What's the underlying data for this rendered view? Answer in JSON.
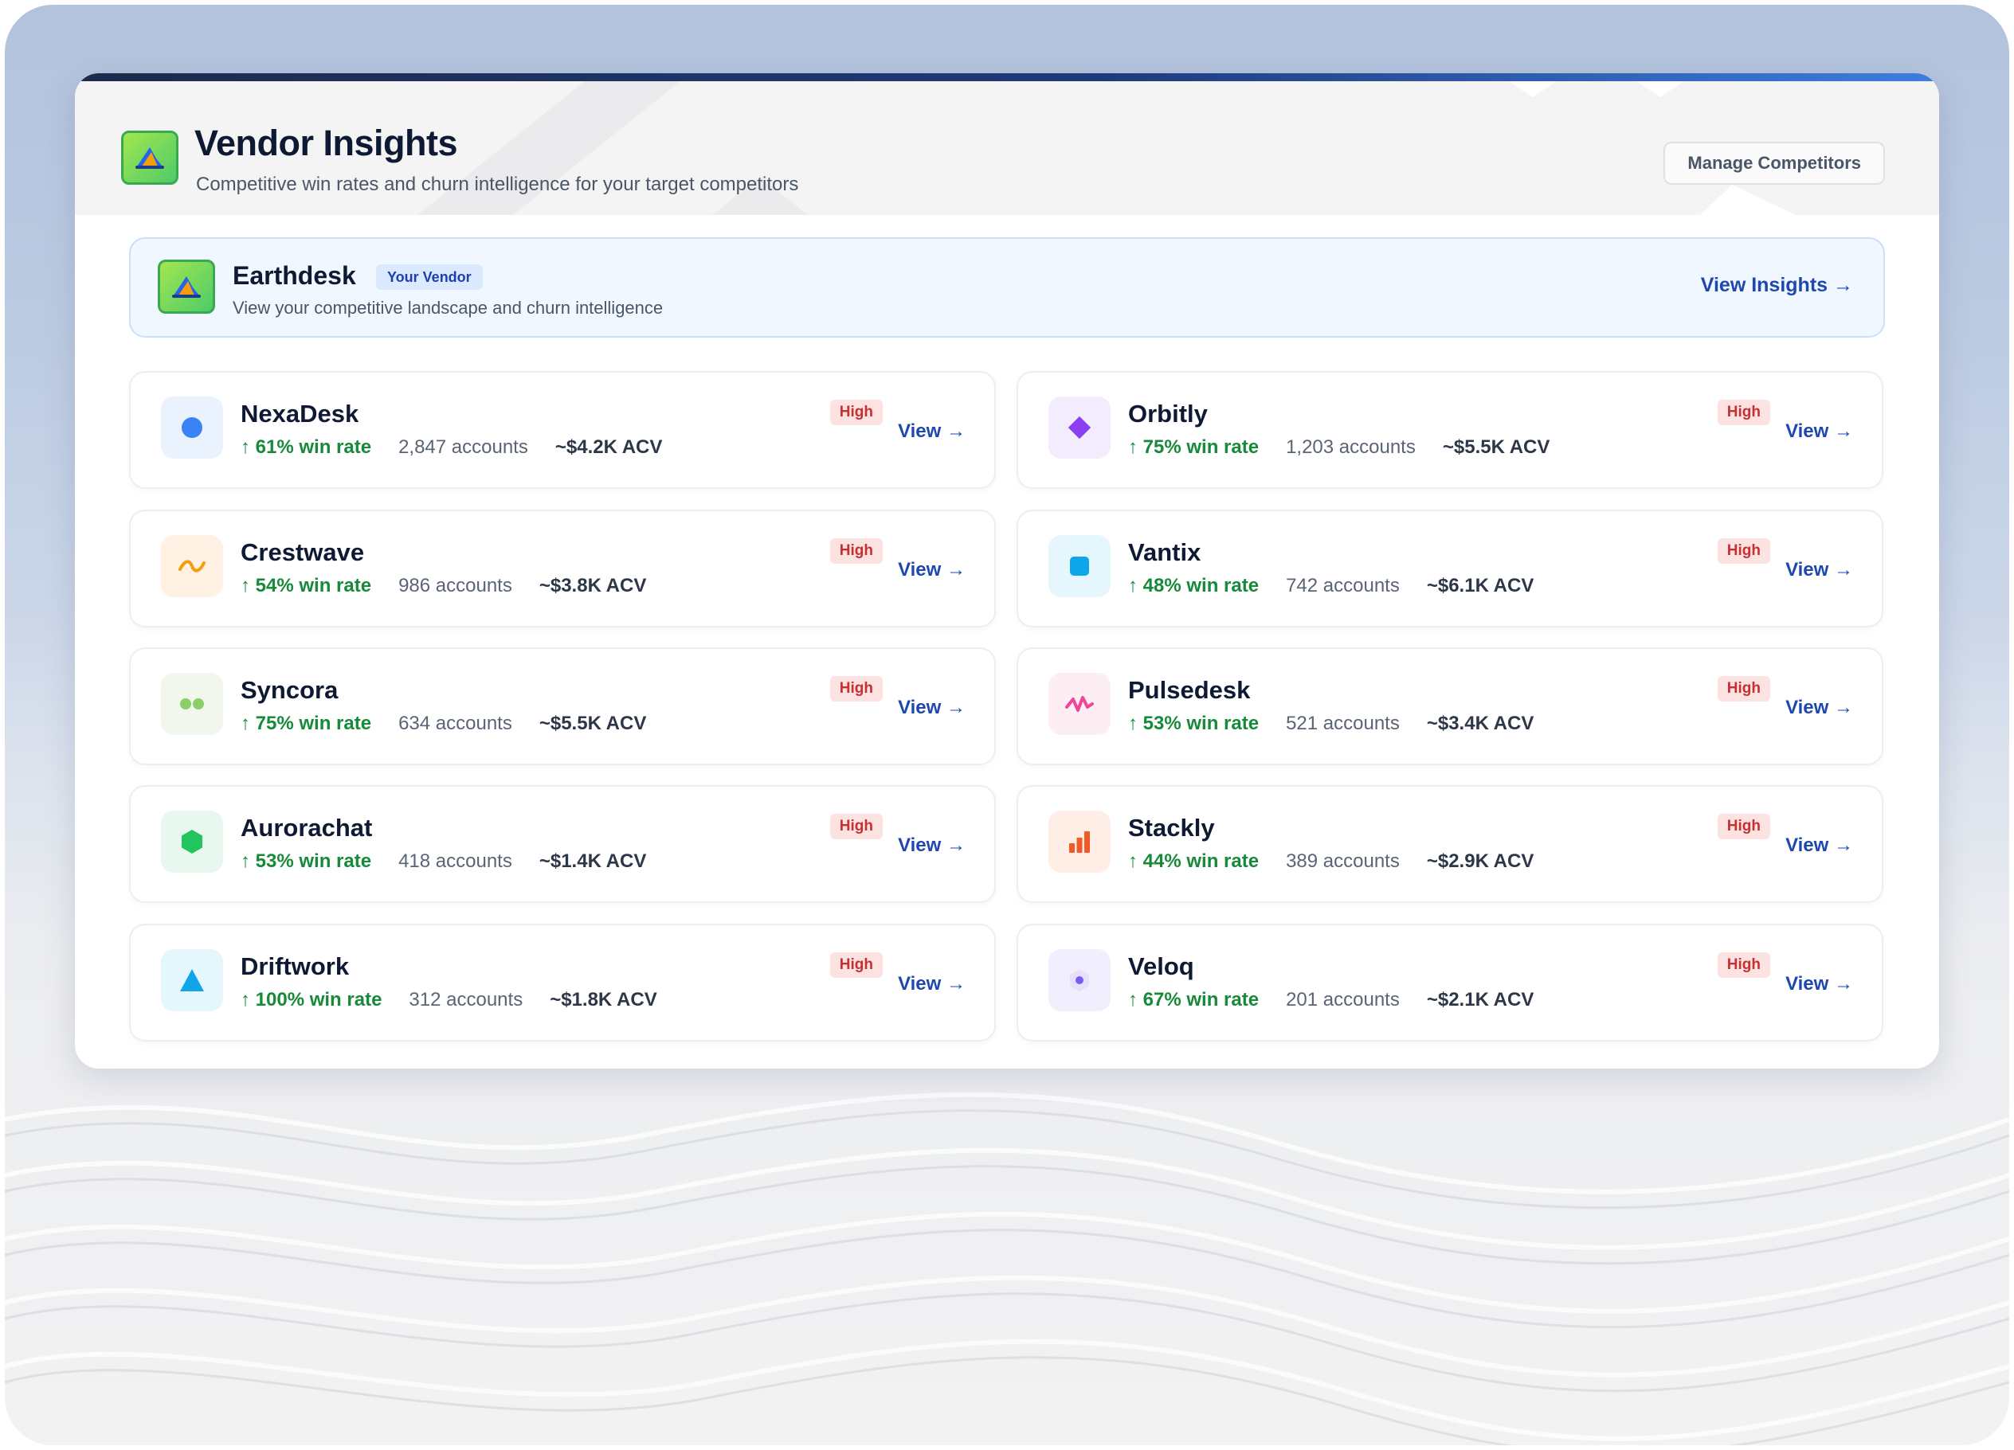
{
  "header": {
    "title": "Vendor Insights",
    "subtitle": "Competitive win rates and churn intelligence for your target competitors",
    "manage_label": "Manage Competitors"
  },
  "vendor": {
    "name": "Earthdesk",
    "badge": "Your Vendor",
    "description": "View your competitive landscape and churn intelligence",
    "link_label": "View Insights →"
  },
  "competitors": [
    {
      "name": "NexaDesk",
      "win": "↑ 61% win rate",
      "accounts": "2,847 accounts",
      "acv": "~$4.2K ACV",
      "badge": "High",
      "view": "View →",
      "icon": "circle-icon",
      "color": "#3b82f6",
      "bg": "#eaf2fe"
    },
    {
      "name": "Orbitly",
      "win": "↑ 75% win rate",
      "accounts": "1,203 accounts",
      "acv": "~$5.5K ACV",
      "badge": "High",
      "view": "View →",
      "icon": "diamond-icon",
      "color": "#8b3ff0",
      "bg": "#f3ebfe"
    },
    {
      "name": "Crestwave",
      "win": "↑ 54% win rate",
      "accounts": "986 accounts",
      "acv": "~$3.8K ACV",
      "badge": "High",
      "view": "View →",
      "icon": "wave-icon",
      "color": "#f59e0b",
      "bg": "#fff1e4"
    },
    {
      "name": "Vantix",
      "win": "↑ 48% win rate",
      "accounts": "742 accounts",
      "acv": "~$6.1K ACV",
      "badge": "High",
      "view": "View →",
      "icon": "square-icon",
      "color": "#0ea5e9",
      "bg": "#e6f6fd"
    },
    {
      "name": "Syncora",
      "win": "↑ 75% win rate",
      "accounts": "634 accounts",
      "acv": "~$5.5K ACV",
      "badge": "High",
      "view": "View →",
      "icon": "two-dots-icon",
      "color": "#8ccf6a",
      "bg": "#f1f7ec"
    },
    {
      "name": "Pulsedesk",
      "win": "↑ 53% win rate",
      "accounts": "521 accounts",
      "acv": "~$3.4K ACV",
      "badge": "High",
      "view": "View →",
      "icon": "pulse-icon",
      "color": "#ec4899",
      "bg": "#fdeef4"
    },
    {
      "name": "Aurorachat",
      "win": "↑ 53% win rate",
      "accounts": "418 accounts",
      "acv": "~$1.4K ACV",
      "badge": "High",
      "view": "View →",
      "icon": "hexagon-icon",
      "color": "#22c55e",
      "bg": "#e8f8ee"
    },
    {
      "name": "Stackly",
      "win": "↑ 44% win rate",
      "accounts": "389 accounts",
      "acv": "~$2.9K ACV",
      "badge": "High",
      "view": "View →",
      "icon": "bars-icon",
      "color": "#f05a28",
      "bg": "#feeee6"
    },
    {
      "name": "Driftwork",
      "win": "↑ 100% win rate",
      "accounts": "312 accounts",
      "acv": "~$1.8K ACV",
      "badge": "High",
      "view": "View →",
      "icon": "triangle-icon",
      "color": "#0ea5e9",
      "bg": "#e6f6fd"
    },
    {
      "name": "Veloq",
      "win": "↑ 67% win rate",
      "accounts": "201 accounts",
      "acv": "~$2.1K ACV",
      "badge": "High",
      "view": "View →",
      "icon": "hex-dot-icon",
      "color": "#7c5cf0",
      "bg": "#f1eefd"
    }
  ]
}
